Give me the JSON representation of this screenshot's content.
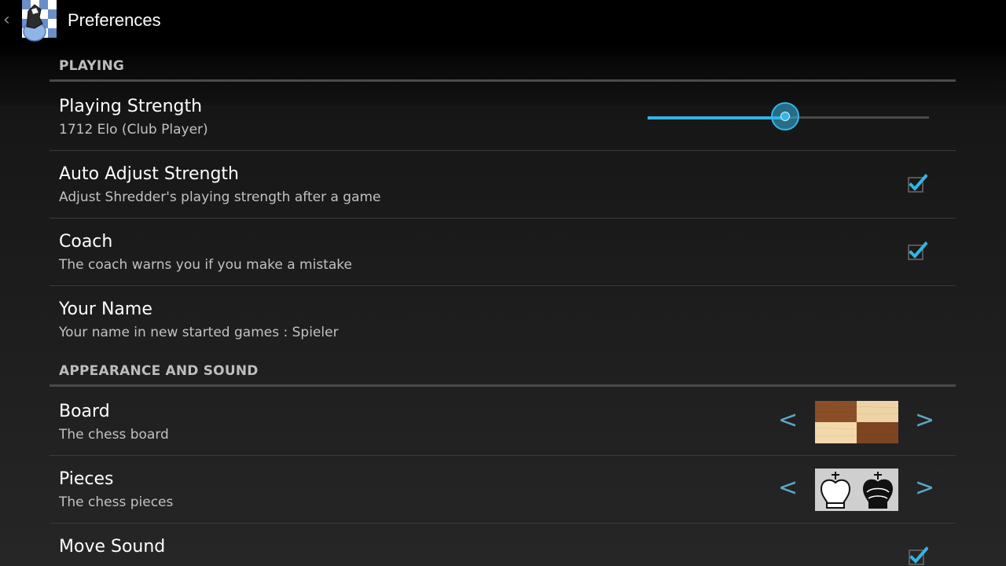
{
  "actionbar": {
    "title": "Preferences",
    "back_glyph": "‹",
    "app_icon": "shredder-chess-icon"
  },
  "sections": {
    "playing": "PLAYING",
    "appearance": "APPEARANCE AND SOUND"
  },
  "prefs": {
    "playing_strength": {
      "title": "Playing Strength",
      "summary": "1712 Elo (Club Player)",
      "slider_value_fraction": 0.49
    },
    "auto_adjust": {
      "title": "Auto Adjust Strength",
      "summary": "Adjust Shredder's playing strength after a game",
      "checked": true
    },
    "coach": {
      "title": "Coach",
      "summary": "The coach warns you if you make a mistake",
      "checked": true
    },
    "your_name": {
      "title": "Your Name",
      "summary": "Your name in new started games : Spieler"
    },
    "board": {
      "title": "Board",
      "summary": "The chess board",
      "prev_label": "<",
      "next_label": ">"
    },
    "pieces": {
      "title": "Pieces",
      "summary": "The chess pieces",
      "prev_label": "<",
      "next_label": ">"
    },
    "move_sound": {
      "title": "Move Sound",
      "checked": true
    }
  },
  "colors": {
    "accent": "#33b5e5",
    "actionbar_bg": "#000000",
    "section_text": "#bdbdbd",
    "summary_text": "#c2c2c2"
  }
}
